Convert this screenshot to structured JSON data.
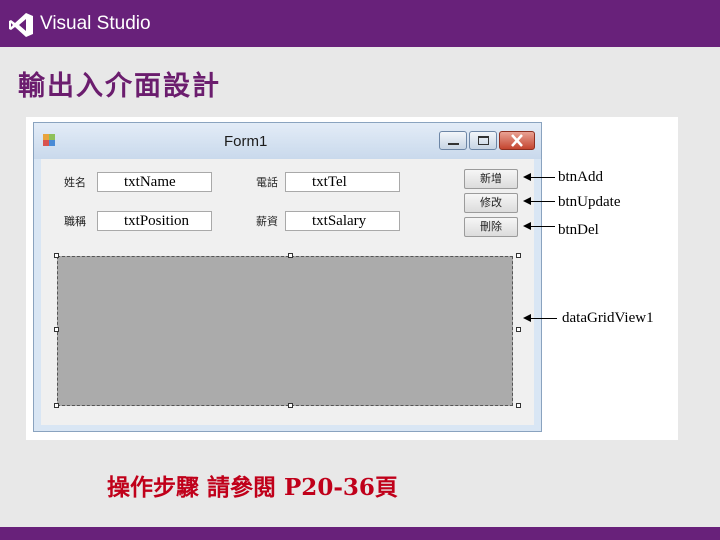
{
  "header": {
    "brand": "Visual Studio",
    "brand_color": "#68217a",
    "logo_icon": "visual-studio-logo"
  },
  "slide": {
    "title": "輸出入介面設計",
    "footer_note": "操作步驟 請參閱  P20-36頁"
  },
  "form": {
    "title": "Form1",
    "app_icon": "form-icon",
    "controls": {
      "name_label": "姓名",
      "name_value": "txtName",
      "tel_label": "電話",
      "tel_value": "txtTel",
      "position_label": "職稱",
      "position_value": "txtPosition",
      "salary_label": "薪資",
      "salary_value": "txtSalary",
      "add_button": "新增",
      "update_button": "修改",
      "delete_button": "刪除"
    }
  },
  "callouts": {
    "btn_add": "btnAdd",
    "btn_update": "btnUpdate",
    "btn_del": "btnDel",
    "grid": "dataGridView1"
  }
}
